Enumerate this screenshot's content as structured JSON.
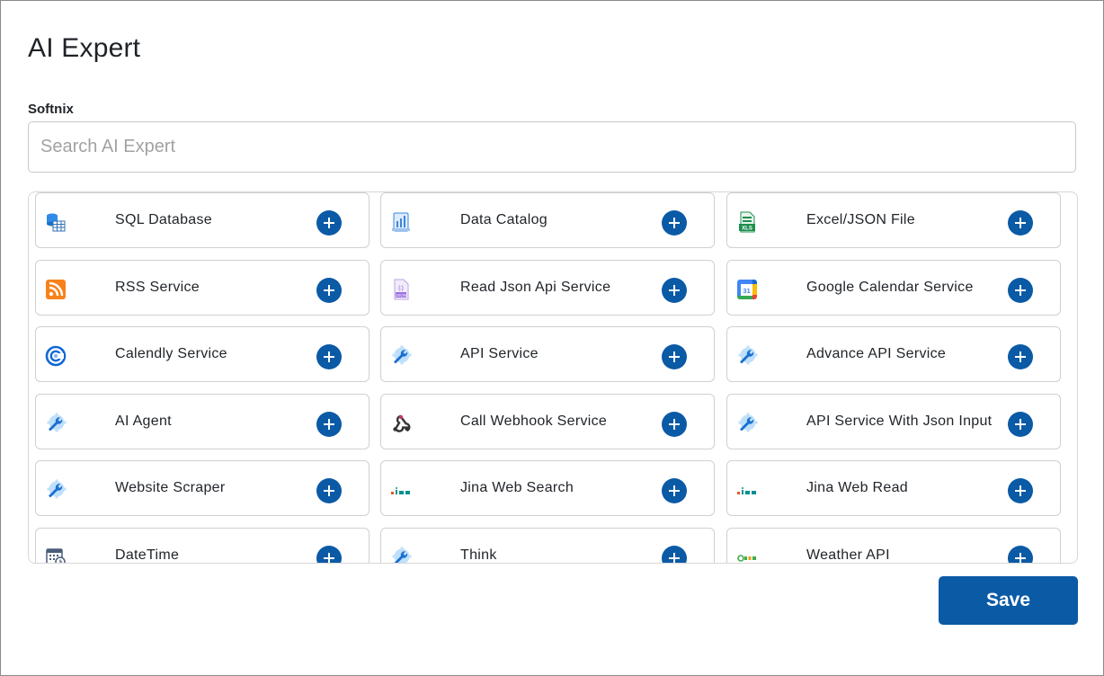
{
  "dialog": {
    "title": "AI Expert",
    "section_label": "Softnix",
    "search": {
      "placeholder": "Search AI Expert",
      "value": ""
    },
    "save_label": "Save"
  },
  "colors": {
    "accent": "#0b5aa6",
    "border": "#d0d0d0"
  },
  "tools": [
    {
      "label": "SQL Database",
      "icon": "database-table-icon"
    },
    {
      "label": "Data Catalog",
      "icon": "data-catalog-icon"
    },
    {
      "label": "Excel/JSON File",
      "icon": "xls-file-icon"
    },
    {
      "label": "RSS Service",
      "icon": "rss-icon"
    },
    {
      "label": "Read Json Api Service",
      "icon": "json-file-icon"
    },
    {
      "label": "Google Calendar Service",
      "icon": "google-calendar-icon"
    },
    {
      "label": "Calendly Service",
      "icon": "calendly-icon"
    },
    {
      "label": "API Service",
      "icon": "wrench-gear-icon"
    },
    {
      "label": "Advance API Service",
      "icon": "wrench-gear-icon"
    },
    {
      "label": "AI Agent",
      "icon": "wrench-gear-icon"
    },
    {
      "label": "Call Webhook Service",
      "icon": "webhook-icon"
    },
    {
      "label": "API Service With Json Input",
      "icon": "wrench-gear-icon"
    },
    {
      "label": "Website Scraper",
      "icon": "wrench-gear-icon"
    },
    {
      "label": "Jina Web Search",
      "icon": "jina-icon"
    },
    {
      "label": "Jina Web Read",
      "icon": "jina-icon"
    },
    {
      "label": "DateTime",
      "icon": "calendar-clock-icon"
    },
    {
      "label": "Think",
      "icon": "wrench-gear-icon"
    },
    {
      "label": "Weather API",
      "icon": "weather-api-icon"
    }
  ]
}
